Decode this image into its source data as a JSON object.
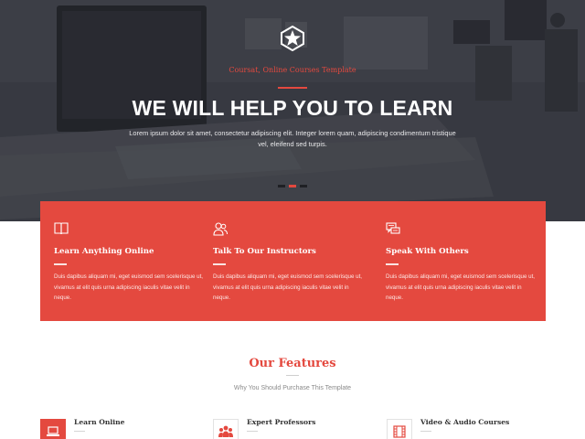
{
  "hero": {
    "tagline": "Coursat, Online Courses Template",
    "headline": "WE WILL HELP YOU TO LEARN",
    "subtext": "Lorem ipsum dolor sit amet, consectetur adipiscing elit. Integer lorem quam, adipiscing condimentum tristique vel, eleifend sed turpis.",
    "slides": 3,
    "active_slide": 2
  },
  "band": {
    "items": [
      {
        "icon": "book-icon",
        "title": "Learn Anything Online",
        "text": "Duis dapibus aliquam mi, eget euismod sem scelerisque ut, vivamus at elit quis urna adipiscing iaculis vitae velit in neque."
      },
      {
        "icon": "users-icon",
        "title": "Talk To Our Instructors",
        "text": "Duis dapibus aliquam mi, eget euismod sem scelerisque ut, vivamus at elit quis urna adipiscing iaculis vitae velit in neque."
      },
      {
        "icon": "chat-icon",
        "title": "Speak With Others",
        "text": "Duis dapibus aliquam mi, eget euismod sem scelerisque ut, vivamus at elit quis urna adipiscing iaculis vitae velit in neque."
      }
    ]
  },
  "features": {
    "title": "Our Features",
    "subtitle": "Why You Should Purchase This Template",
    "items": [
      {
        "icon": "laptop-icon",
        "label": "Learn Online"
      },
      {
        "icon": "group-icon",
        "label": "Expert Professors"
      },
      {
        "icon": "film-icon",
        "label": "Video & Audio Courses"
      }
    ]
  },
  "colors": {
    "accent": "#e4493f",
    "hero_bg": "#3f4249"
  }
}
